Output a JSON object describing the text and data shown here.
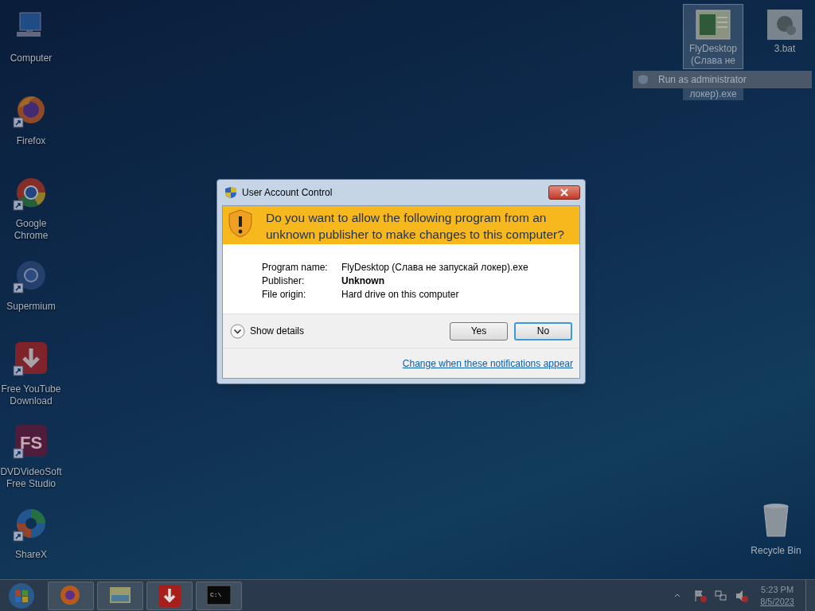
{
  "desktop_left": [
    {
      "kind": "computer",
      "label": "Computer",
      "shortcut": false
    },
    {
      "kind": "firefox",
      "label": "Firefox",
      "shortcut": true
    },
    {
      "kind": "chrome",
      "label": "Google Chrome",
      "shortcut": true
    },
    {
      "kind": "supermium",
      "label": "Supermium",
      "shortcut": true
    },
    {
      "kind": "download",
      "label": "Free YouTube Download",
      "shortcut": true
    },
    {
      "kind": "fs",
      "label": "DVDVideoSoft Free Studio",
      "shortcut": true,
      "icon_text": "FS"
    },
    {
      "kind": "sharex",
      "label": "ShareX",
      "shortcut": true
    }
  ],
  "desktop_right": [
    {
      "kind": "exe",
      "label_lines": [
        "FlyDesktop",
        "(Слава не",
        "локер).exe"
      ],
      "selected": true
    },
    {
      "kind": "bat",
      "label_lines": [
        "3.bat"
      ],
      "selected": false
    }
  ],
  "context_menu": {
    "items": [
      {
        "label": "Run as administrator"
      }
    ]
  },
  "recycle_bin": {
    "label": "Recycle Bin"
  },
  "dialog": {
    "title": "User Account Control",
    "heading": "Do you want to allow the following program from an unknown publisher to make changes to this computer?",
    "details": [
      {
        "label": "Program name:",
        "value": "FlyDesktop (Слава не запускай локер).exe",
        "bold": false
      },
      {
        "label": "Publisher:",
        "value": "Unknown",
        "bold": true
      },
      {
        "label": "File origin:",
        "value": "Hard drive on this computer",
        "bold": false
      }
    ],
    "show_details": {
      "label": "Show details",
      "expanded": false
    },
    "buttons": [
      {
        "label": "Yes",
        "default": false
      },
      {
        "label": "No",
        "default": true
      }
    ],
    "link": "Change when these notifications appear"
  },
  "taskbar": {
    "items": [
      {
        "kind": "firefox"
      },
      {
        "kind": "explorer"
      },
      {
        "kind": "download"
      },
      {
        "kind": "console",
        "icon_text": "C:\\"
      }
    ],
    "tray": [
      {
        "kind": "chevron"
      },
      {
        "kind": "flag"
      },
      {
        "kind": "network"
      },
      {
        "kind": "speaker"
      }
    ],
    "time": "5:23 PM",
    "date": "8/5/2023"
  }
}
